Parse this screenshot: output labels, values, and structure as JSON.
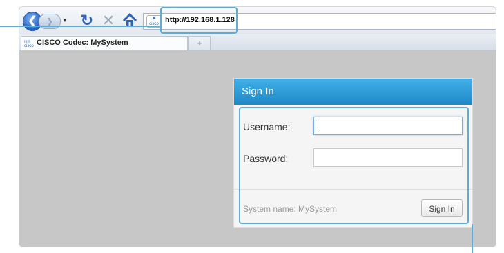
{
  "browser": {
    "url": "http://192.168.1.128",
    "site_icon_text": "cisco",
    "tab_title": "CISCO Codec: MySystem",
    "new_tab_symbol": "+"
  },
  "icons": {
    "back": "back-arrow-icon",
    "forward": "forward-arrow-icon",
    "refresh": "refresh-icon",
    "stop": "stop-icon",
    "home": "home-icon",
    "site": "cisco-favicon-icon"
  },
  "signin": {
    "header": "Sign In",
    "username_label": "Username:",
    "username_value": "",
    "password_label": "Password:",
    "password_value": "",
    "system_name": "System name: MySystem",
    "button_label": "Sign In"
  },
  "colors": {
    "header_blue": "#2b9ad8",
    "callout_blue": "#5aaed8",
    "page_gray": "#c7c7c7"
  }
}
